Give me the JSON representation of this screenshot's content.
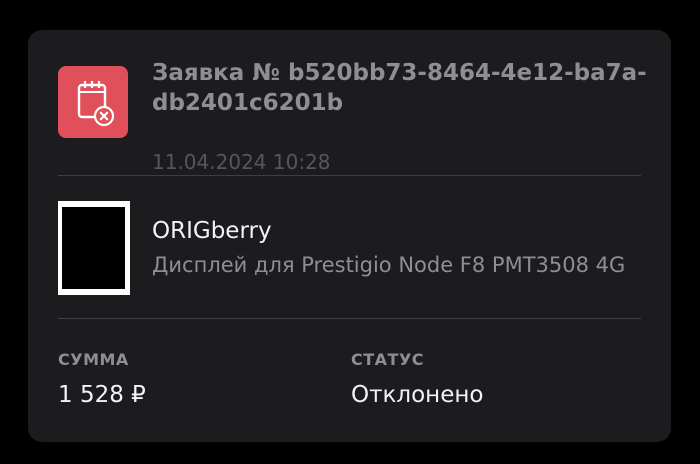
{
  "order": {
    "icon": "receipt-cancel-icon",
    "title": "Заявка № b520bb73-8464-4e12-ba7a-db2401c6201b",
    "date": "11.04.2024 10:28"
  },
  "product": {
    "thumbnail": "product-thumbnail",
    "brand": "ORIGberry",
    "name": "Дисплей для Prestigio Node F8 PMT3508 4G"
  },
  "summary": {
    "sum_label": "СУММА",
    "sum_value": "1 528 ₽",
    "status_label": "СТАТУС",
    "status_value": "Отклонено"
  },
  "colors": {
    "background": "#000000",
    "card": "#1c1c1e",
    "icon_accent": "#e0505a",
    "primary_text": "#f2f2f7",
    "secondary_text": "#8e8e93"
  }
}
